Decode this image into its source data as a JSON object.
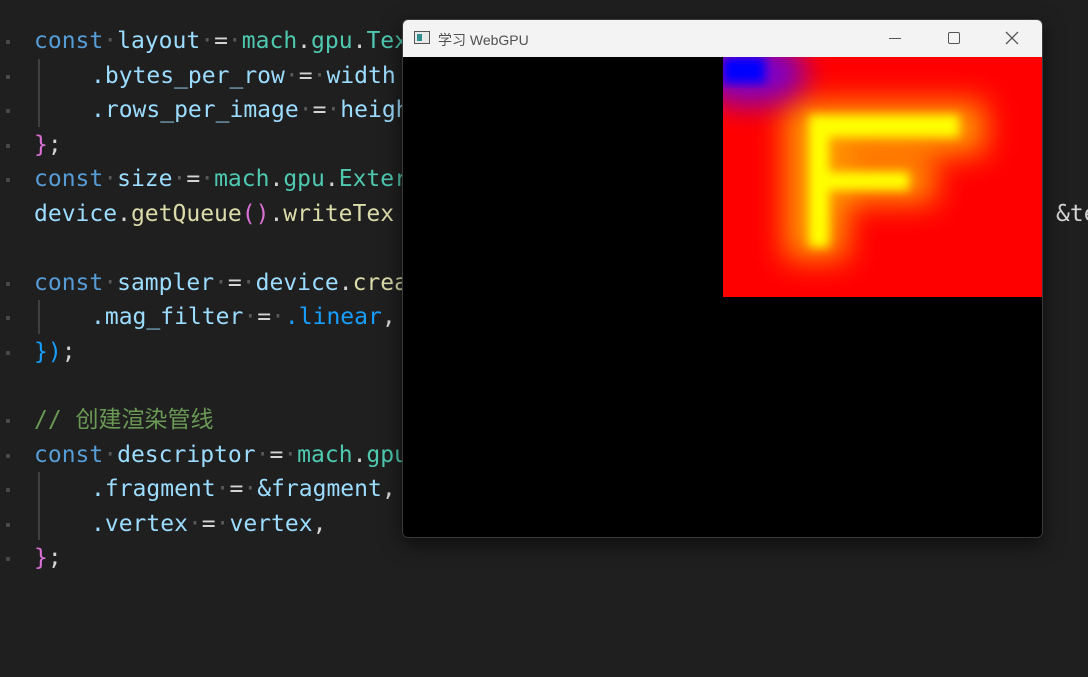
{
  "editor": {
    "lines": {
      "l1": {
        "k": "const",
        "name": "layout",
        "eq": "=",
        "ns1": "mach",
        "ns2": "gpu",
        "type": "Tex"
      },
      "l2": {
        "field": ".bytes_per_row",
        "eq": "=",
        "val": "width"
      },
      "l3": {
        "field": ".rows_per_image",
        "eq": "=",
        "val": "heigh"
      },
      "l4": {
        "brace": "}",
        "semi": ";"
      },
      "l5": {
        "k": "const",
        "name": "size",
        "eq": "=",
        "ns1": "mach",
        "ns2": "gpu",
        "type": "Exter"
      },
      "l6": {
        "obj": "device",
        "fn1": "getQueue",
        "fn2": "writeTex",
        "tail": "&te"
      },
      "l7": {
        "k": "const",
        "name": "sampler",
        "eq": "=",
        "obj": "device",
        "fn": "crea"
      },
      "l8": {
        "field": ".mag_filter",
        "eq": "=",
        "val": ".linear",
        "comma": ","
      },
      "l9": {
        "close": "})",
        "semi": ";"
      },
      "l10": {
        "comment": "// 创建渲染管线"
      },
      "l11": {
        "k": "const",
        "name": "descriptor",
        "eq": "=",
        "ns1": "mach",
        "ns2": "gpu"
      },
      "l12": {
        "field": ".fragment",
        "eq": "=",
        "val": "&fragment",
        "comma": ","
      },
      "l13": {
        "field": ".vertex",
        "eq": "=",
        "val": "vertex",
        "comma": ","
      },
      "l14": {
        "brace": "}",
        "semi": ";"
      }
    }
  },
  "window": {
    "title": "学习 WebGPU",
    "buttons": {
      "minimize": "minimize",
      "maximize": "maximize",
      "close": "close"
    }
  },
  "render": {
    "background": "#000000",
    "texture_bg": "#ff0000",
    "letter": "F",
    "letter_color": "#ffff00",
    "corner_color": "#0000ff"
  }
}
